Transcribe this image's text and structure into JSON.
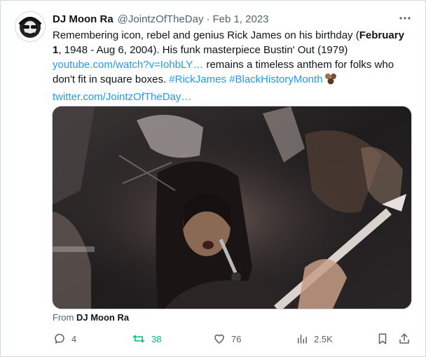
{
  "tweet": {
    "author_name": "DJ Moon Ra",
    "handle": "@JointzOfTheDay",
    "separator": "·",
    "date": "Feb 1, 2023",
    "text_1": "Remembering icon, rebel and genius Rick James on his birthday (",
    "text_bold": "February 1",
    "text_2": ", 1948 - Aug 6, 2004). His funk masterpiece Bustin' Out (1979)",
    "link_1": "youtube.com/watch?v=IohbLY…",
    "text_3": " remains a timeless anthem for folks who don't fit in square boxes. ",
    "hashtag_1": "#RickJames",
    "hashtag_2": "#BlackHistoryMonth",
    "link_2": "twitter.com/JointzOfTheDay…",
    "from_label": "From",
    "from_name": "DJ Moon Ra"
  },
  "actions": {
    "replies": "4",
    "retweets": "38",
    "likes": "76",
    "views": "2.5K"
  },
  "colors": {
    "accent": "#1d9bf0",
    "retweet": "#00ba7c",
    "muted": "#536471"
  },
  "icons": [
    "more-icon",
    "reply-icon",
    "retweet-icon",
    "like-icon",
    "views-icon",
    "bookmark-icon",
    "share-icon"
  ]
}
